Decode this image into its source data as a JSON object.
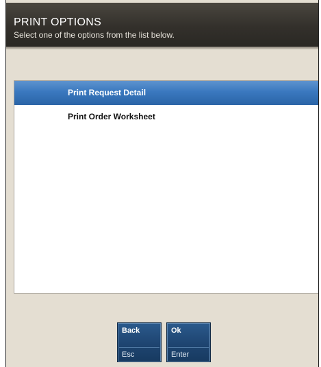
{
  "header": {
    "title": "PRINT OPTIONS",
    "subtitle": "Select one of the options from the list below."
  },
  "options": [
    {
      "label": "Print Request Detail",
      "selected": true
    },
    {
      "label": "Print Order Worksheet",
      "selected": false
    }
  ],
  "buttons": {
    "back": {
      "label": "Back",
      "key": "Esc"
    },
    "ok": {
      "label": "Ok",
      "key": "Enter"
    }
  },
  "colors": {
    "header_bg": "#33302b",
    "selection": "#3a78bf",
    "button": "#1f4673",
    "panel_bg": "#e4ded2"
  }
}
